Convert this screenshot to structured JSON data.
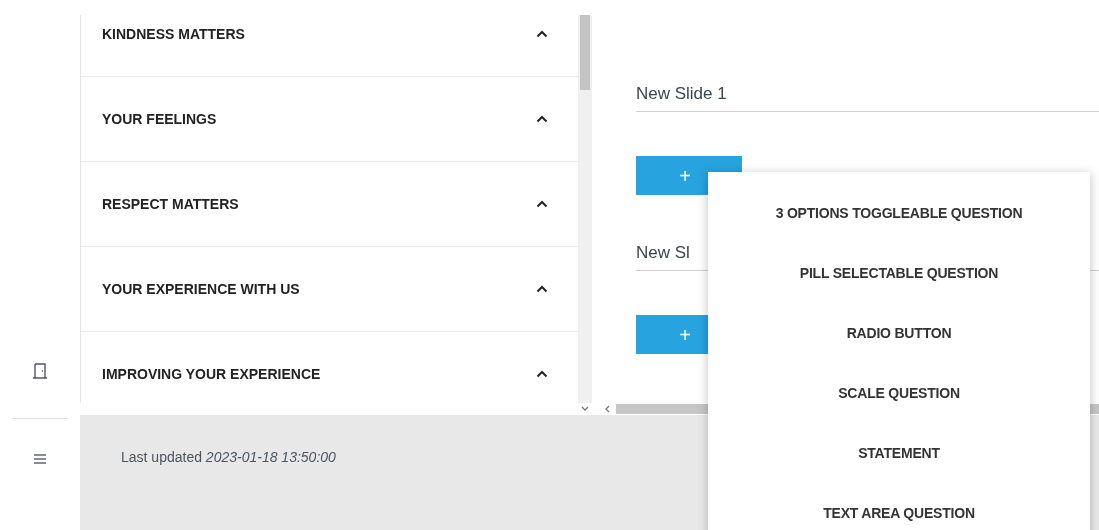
{
  "sections": [
    {
      "title": "KINDNESS MATTERS"
    },
    {
      "title": "YOUR FEELINGS"
    },
    {
      "title": "RESPECT MATTERS"
    },
    {
      "title": "YOUR EXPERIENCE WITH US"
    },
    {
      "title": "IMPROVING YOUR EXPERIENCE"
    }
  ],
  "slides": [
    {
      "name": "New Slide 1",
      "button": "+"
    },
    {
      "name": "New Sl",
      "button": "+"
    }
  ],
  "footer": {
    "label": "Last updated",
    "timestamp": "2023-01-18 13:50:00"
  },
  "question_menu": [
    {
      "label": "3 OPTIONS TOGGLEABLE QUESTION"
    },
    {
      "label": "PILL SELECTABLE QUESTION"
    },
    {
      "label": "RADIO BUTTON"
    },
    {
      "label": "SCALE QUESTION"
    },
    {
      "label": "STATEMENT"
    },
    {
      "label": "TEXT AREA QUESTION"
    }
  ]
}
